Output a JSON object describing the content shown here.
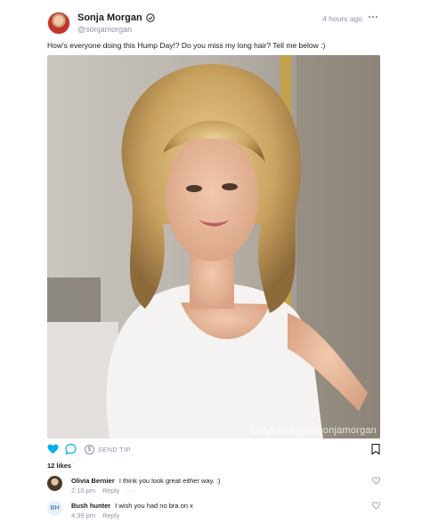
{
  "post": {
    "author_name": "Sonja Morgan",
    "handle": "@sonjamorgan",
    "timestamp": "4 hours ago",
    "caption": "How's everyone doing this Hump Day!? Do you miss my long hair? Tell me below :)",
    "watermark": "OnlyFans.com/sonjamorgan"
  },
  "actions": {
    "tip_label": "SEND TIP",
    "tip_symbol": "$",
    "likes": "12 likes"
  },
  "comments": [
    {
      "author": "Olivia Bernier",
      "text": "I think you look great either way. :)",
      "time": "2:10 pm",
      "reply": "Reply",
      "more": "···"
    },
    {
      "author": "Bush hunter",
      "initials": "BH",
      "text": "I wish you had no bra on x",
      "time": "4:39 pm",
      "reply": "Reply"
    }
  ],
  "colors": {
    "accent": "#00aff0",
    "muted": "#8a96a3"
  },
  "icons": [
    "verified-icon",
    "more-icon",
    "heart-icon",
    "comment-icon",
    "bookmark-icon"
  ]
}
